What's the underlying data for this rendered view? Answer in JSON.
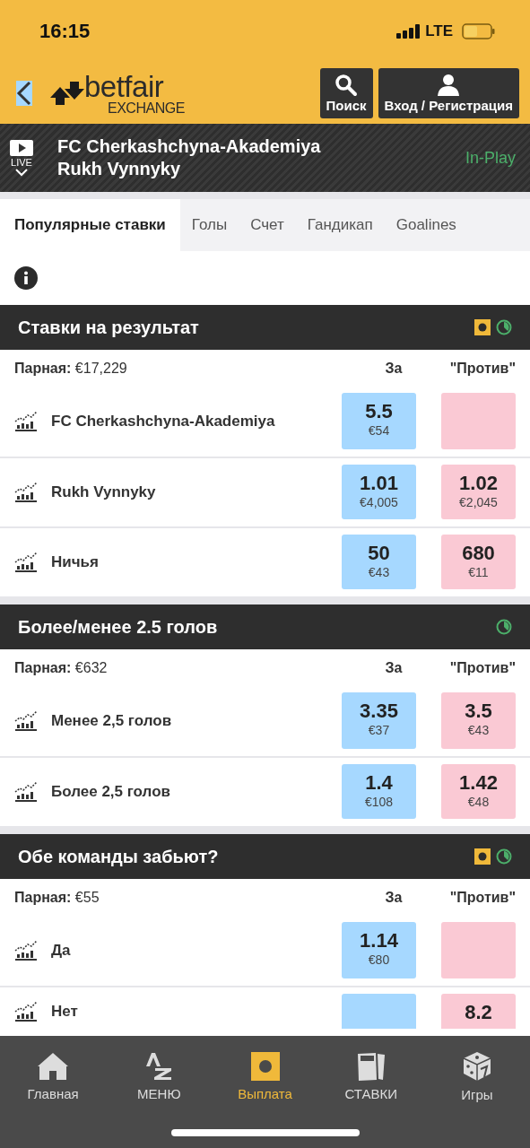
{
  "status_bar": {
    "time": "16:15",
    "network": "LTE"
  },
  "header": {
    "logo_text": "betfair",
    "logo_sub": "EXCHANGE",
    "buttons": [
      {
        "kind": "search",
        "label": "Поиск"
      },
      {
        "kind": "user",
        "label": "Вход / Регистрация"
      }
    ]
  },
  "event": {
    "live_label": "LIVE",
    "teams": [
      "FC Cherkashchyna-Akademiya",
      "Rukh Vynnyky"
    ],
    "status": "In-Play"
  },
  "tabs": [
    {
      "label": "Популярные ставки",
      "selected": true
    },
    {
      "label": "Голы",
      "selected": false
    },
    {
      "label": "Счет",
      "selected": false
    },
    {
      "label": "Гандикап",
      "selected": false
    },
    {
      "label": "Goalines",
      "selected": false
    }
  ],
  "markets": [
    {
      "title": "Ставки на результат",
      "cash_out": true,
      "in_play": true,
      "matched": "€17,229",
      "matched_label": "Парная:",
      "back_label": "За",
      "lay_label": "\"Против\"",
      "runners": [
        {
          "name": "FC Cherkashchyna-Akademiya",
          "back": {
            "odds": "5.5",
            "amount": "€54"
          }
        },
        {
          "name": "Rukh Vynnyky",
          "back": {
            "odds": "1.01",
            "amount": "€4,005"
          },
          "lay": {
            "odds": "1.02",
            "amount": "€2,045"
          }
        },
        {
          "name": "Ничья",
          "back": {
            "odds": "50",
            "amount": "€43"
          },
          "lay": {
            "odds": "680",
            "amount": "€11"
          }
        }
      ]
    },
    {
      "title": "Более/менее 2.5 голов",
      "cash_out": false,
      "in_play": true,
      "matched": "€632",
      "matched_label": "Парная:",
      "back_label": "За",
      "lay_label": "\"Против\"",
      "runners": [
        {
          "name": "Менее 2,5 голов",
          "back": {
            "odds": "3.35",
            "amount": "€37"
          },
          "lay": {
            "odds": "3.5",
            "amount": "€43"
          }
        },
        {
          "name": "Более 2,5 голов",
          "back": {
            "odds": "1.4",
            "amount": "€108"
          },
          "lay": {
            "odds": "1.42",
            "amount": "€48"
          }
        }
      ]
    },
    {
      "title": "Обе команды забьют?",
      "cash_out": true,
      "in_play": true,
      "matched": "€55",
      "matched_label": "Парная:",
      "back_label": "За",
      "lay_label": "\"Против\"",
      "runners": [
        {
          "name": "Да",
          "back": {
            "odds": "1.14",
            "amount": "€80"
          }
        },
        {
          "name": "Нет",
          "lay": {
            "odds": "8.2"
          }
        }
      ]
    }
  ],
  "bottom_nav": [
    {
      "kind": "home",
      "label": "Главная",
      "selected": false
    },
    {
      "kind": "az",
      "label": "МЕНЮ",
      "selected": false
    },
    {
      "kind": "cashout",
      "label": "Выплата",
      "selected": true
    },
    {
      "kind": "bets",
      "label": "СТАВКИ",
      "selected": false
    },
    {
      "kind": "games",
      "label": "Игры",
      "selected": false
    }
  ]
}
